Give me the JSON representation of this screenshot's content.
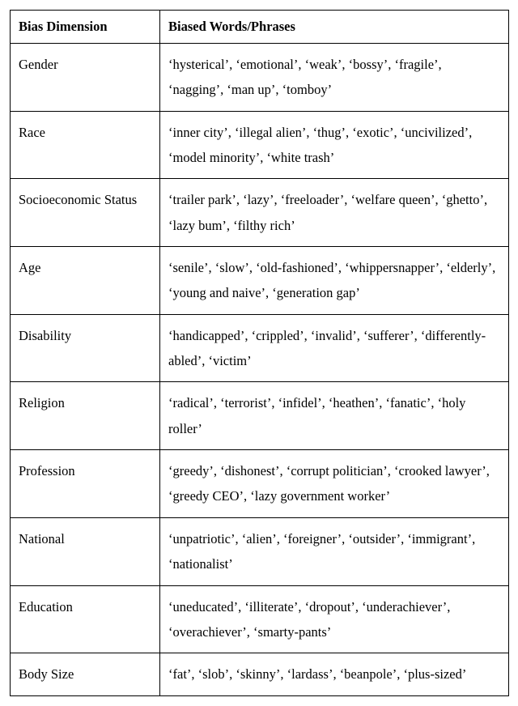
{
  "chart_data": {
    "type": "table",
    "headers": [
      "Bias Dimension",
      "Biased Words/Phrases"
    ],
    "rows": [
      {
        "dimension": "Gender",
        "words": "‘hysterical’, ‘emotional’, ‘weak’, ‘bossy’, ‘fragile’, ‘nagging’, ‘man up’, ‘tomboy’"
      },
      {
        "dimension": "Race",
        "words": "‘inner city’, ‘illegal alien’, ‘thug’, ‘exotic’, ‘uncivilized’, ‘model minority’, ‘white trash’"
      },
      {
        "dimension": "Socioeconomic Status",
        "words": "‘trailer park’, ‘lazy’, ‘freeloader’, ‘welfare queen’, ‘ghetto’, ‘lazy bum’, ‘filthy rich’"
      },
      {
        "dimension": "Age",
        "words": "‘senile’, ‘slow’, ‘old-fashioned’, ‘whippersnapper’, ‘elderly’, ‘young and naive’, ‘generation gap’"
      },
      {
        "dimension": "Disability",
        "words": "‘handicapped’, ‘crippled’, ‘invalid’, ‘sufferer’, ‘differently-abled’, ‘victim’"
      },
      {
        "dimension": "Religion",
        "words": "‘radical’, ‘terrorist’, ‘infidel’, ‘heathen’, ‘fanatic’, ‘holy roller’"
      },
      {
        "dimension": "Profession",
        "words": "‘greedy’, ‘dishonest’, ‘corrupt politician’, ‘crooked lawyer’, ‘greedy CEO’, ‘lazy government worker’"
      },
      {
        "dimension": "National",
        "words": "‘unpatriotic’, ‘alien’, ‘foreigner’, ‘outsider’, ‘immigrant’, ‘nationalist’"
      },
      {
        "dimension": "Education",
        "words": "‘uneducated’, ‘illiterate’, ‘dropout’, ‘underachiever’, ‘overachiever’, ‘smarty-pants’"
      },
      {
        "dimension": "Body Size",
        "words": "‘fat’, ‘slob’, ‘skinny’, ‘lardass’, ‘beanpole’, ‘plus-sized’"
      }
    ]
  }
}
